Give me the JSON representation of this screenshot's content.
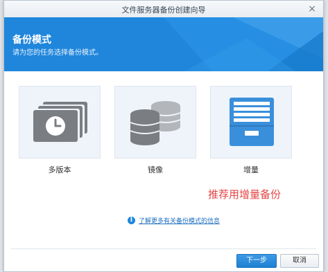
{
  "window": {
    "title": "文件服务器备份创建向导"
  },
  "banner": {
    "heading": "备份模式",
    "subtitle": "请为您的任务选择备份模式。"
  },
  "modes": [
    {
      "label": "多版本",
      "icon": "multi-version-clock-icon"
    },
    {
      "label": "镜像",
      "icon": "mirror-database-icon"
    },
    {
      "label": "增量",
      "icon": "incremental-archive-icon"
    }
  ],
  "annotation": {
    "text": "推荐用增量备份"
  },
  "info": {
    "link": "了解更多有关备份模式的信息"
  },
  "footer": {
    "next_label": "下一步",
    "cancel_label": "取消"
  },
  "colors": {
    "accent": "#1f86dc",
    "icon_gray": "#7a7d82",
    "icon_blue": "#3a8fdb",
    "annotation": "#e54545"
  }
}
